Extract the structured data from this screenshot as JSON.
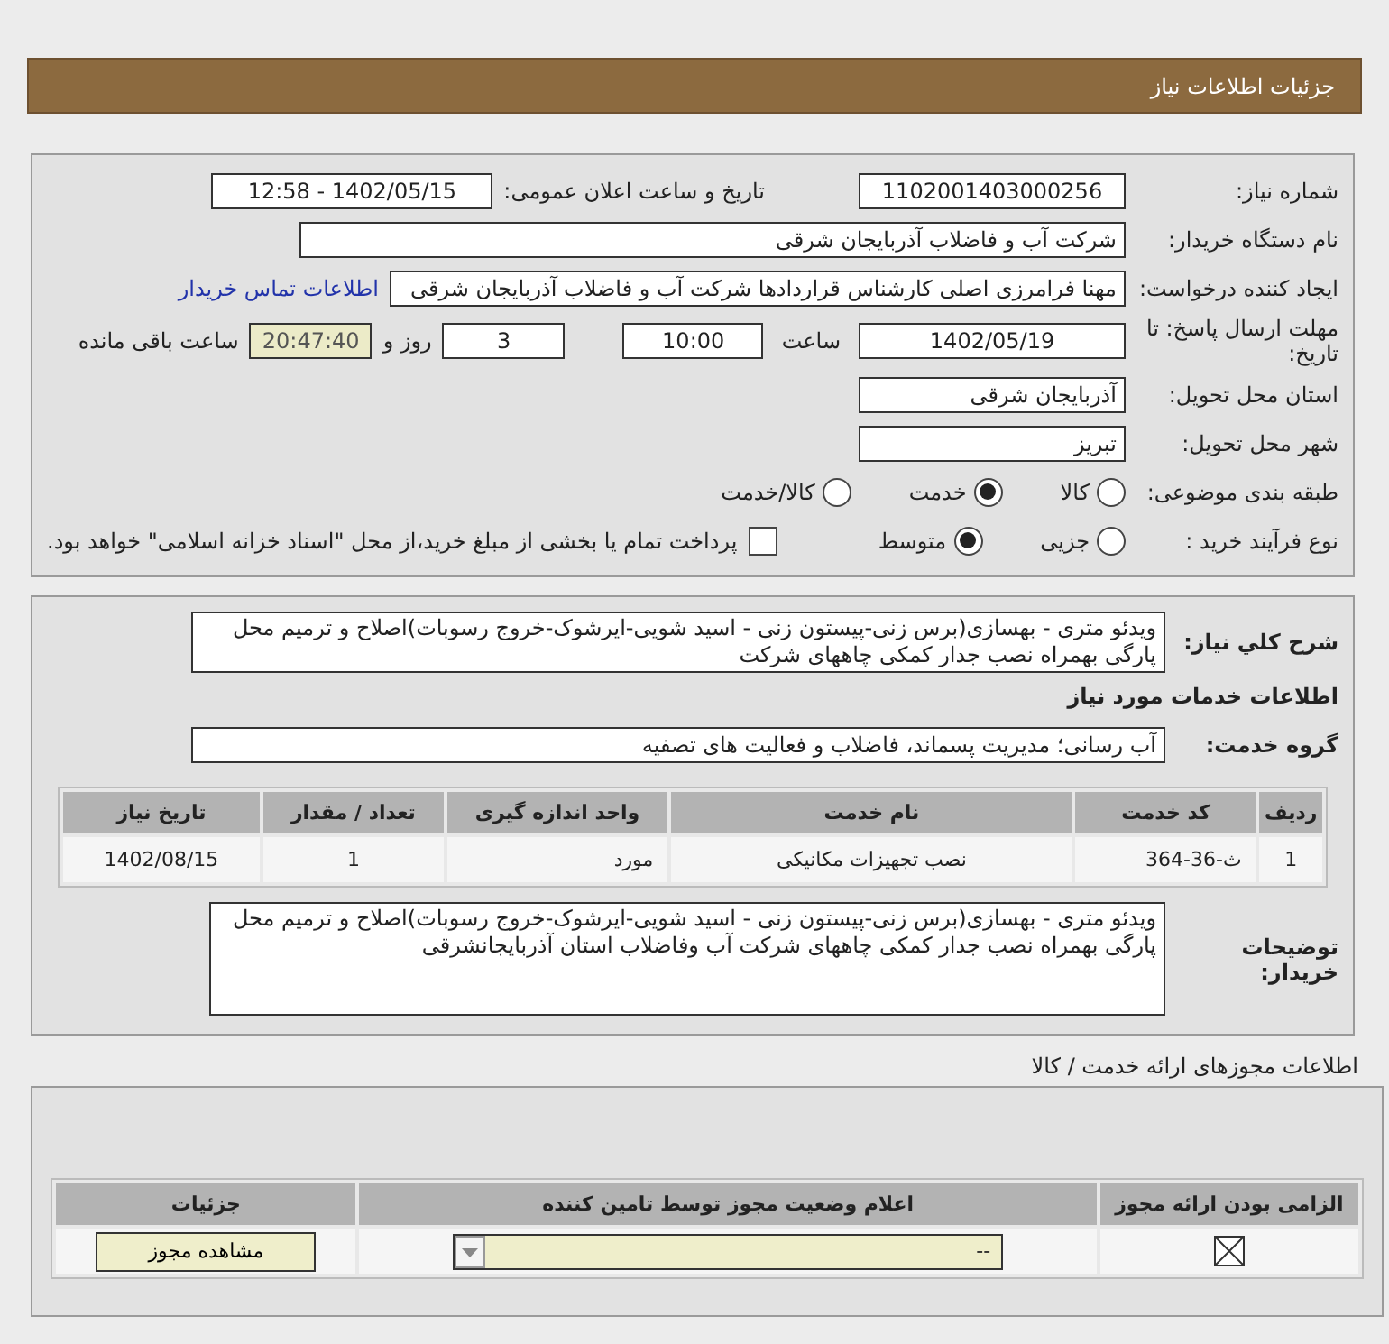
{
  "header": {
    "title": "جزئیات اطلاعات نیاز"
  },
  "need_number": {
    "label": "شماره نیاز:",
    "value": "1102001403000256"
  },
  "announce": {
    "label": "تاریخ و ساعت اعلان عمومی:",
    "value": "1402/05/15 - 12:58"
  },
  "buyer_org": {
    "label": "نام دستگاه خریدار:",
    "value": "شرکت آب و فاضلاب آذربایجان شرقی"
  },
  "requester": {
    "label": "ایجاد کننده درخواست:",
    "value": "مهنا فرامرزی اصلی کارشناس قراردادها شرکت آب و فاضلاب آذربایجان شرقی",
    "link": "اطلاعات تماس خریدار"
  },
  "deadline": {
    "label": "مهلت ارسال پاسخ: تا تاریخ:",
    "date": "1402/05/19",
    "time_label": "ساعت",
    "time": "10:00",
    "days": "3",
    "days_label": "روز و",
    "remaining": "20:47:40",
    "remaining_label": "ساعت باقی مانده"
  },
  "province": {
    "label": "استان محل تحویل:",
    "value": "آذربایجان شرقی"
  },
  "city": {
    "label": "شهر محل تحویل:",
    "value": "تبریز"
  },
  "category": {
    "label": "طبقه بندی موضوعی:",
    "options": [
      {
        "label": "کالا",
        "selected": false
      },
      {
        "label": "خدمت",
        "selected": true
      },
      {
        "label": "کالا/خدمت",
        "selected": false
      }
    ]
  },
  "purchase_type": {
    "label": "نوع فرآیند خرید :",
    "options": [
      {
        "label": "جزیی",
        "selected": false
      },
      {
        "label": "متوسط",
        "selected": true
      }
    ],
    "payment": {
      "checked": false,
      "text": "پرداخت تمام یا بخشی از مبلغ خرید،از محل \"اسناد خزانه اسلامی\" خواهد بود."
    }
  },
  "description": {
    "label": "شرح کلي نياز:",
    "text": "ویدئو متری - بهسازی(برس زنی-پیستون زنی - اسید شویی-ایرشوک-خروج رسوبات)اصلاح و ترمیم محل پارگی بهمراه نصب جدار کمکی چاههای شرکت"
  },
  "services": {
    "title": "اطلاعات خدمات مورد نیاز",
    "group_label": "گروه خدمت:",
    "group": "آب رسانی؛ مدیریت پسماند، فاضلاب و فعالیت های تصفیه",
    "columns": [
      "ردیف",
      "کد خدمت",
      "نام خدمت",
      "واحد اندازه گیری",
      "تعداد / مقدار",
      "تاریخ نیاز"
    ],
    "rows": [
      [
        "1",
        "ث-36-364",
        "نصب تجهیزات مکانیکی",
        "مورد",
        "1",
        "1402/08/15"
      ]
    ]
  },
  "buyer_notes": {
    "label": "توضیحات خریدار:",
    "text": "ویدئو متری - بهسازی(برس زنی-پیستون زنی - اسید شویی-ایرشوک-خروج رسوبات)اصلاح و ترمیم محل پارگی بهمراه نصب جدار کمکی چاههای شرکت آب وفاضلاب استان آذربایجانشرقی"
  },
  "permits": {
    "title": "اطلاعات مجوزهای ارائه خدمت / کالا",
    "columns": [
      "الزامی بودن ارائه مجوز",
      "اعلام وضعیت مجوز توسط تامین کننده",
      "جزئیات"
    ],
    "rows": [
      {
        "required": true,
        "status": "--",
        "action": "مشاهده مجوز"
      }
    ]
  }
}
